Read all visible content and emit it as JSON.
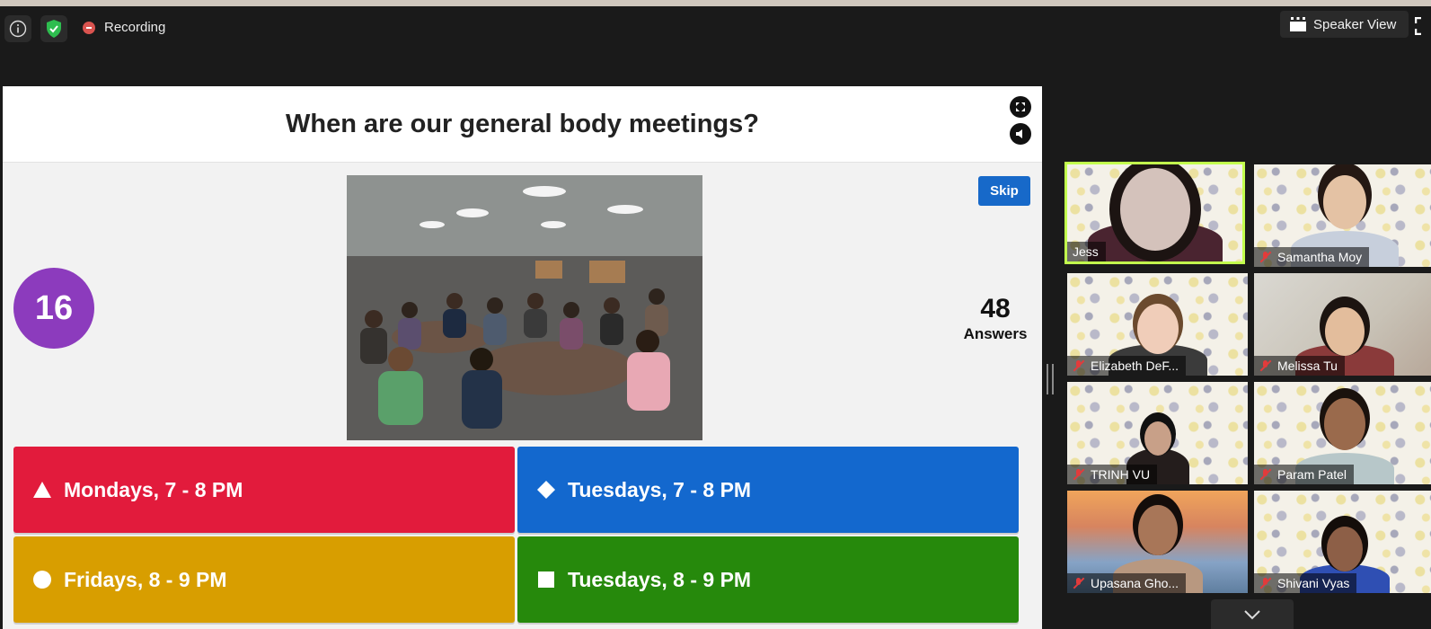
{
  "toolbar": {
    "recording_label": "Recording",
    "speaker_view_label": "Speaker View"
  },
  "question": {
    "text": "When are our general body meetings?",
    "skip_label": "Skip",
    "timer": "16",
    "answers_count": "48",
    "answers_label": "Answers",
    "options": [
      {
        "label": "Mondays, 7 - 8 PM",
        "shape": "triangle-icon",
        "color": "#e21b3c"
      },
      {
        "label": "Tuesdays, 7 - 8 PM",
        "shape": "diamond-icon",
        "color": "#1368ce"
      },
      {
        "label": "Fridays, 8 - 9 PM",
        "shape": "circle-icon",
        "color": "#d89e00"
      },
      {
        "label": "Tuesdays, 8 - 9 PM",
        "shape": "square-icon",
        "color": "#26890c"
      }
    ]
  },
  "participants": [
    {
      "name": "Jess",
      "muted": false,
      "active": true
    },
    {
      "name": "Samantha Moy",
      "muted": true
    },
    {
      "name": "Elizabeth DeF...",
      "muted": true
    },
    {
      "name": "Melissa Tu",
      "muted": true
    },
    {
      "name": "TRINH VU",
      "muted": true
    },
    {
      "name": "Param Patel",
      "muted": true
    },
    {
      "name": "Upasana Gho...",
      "muted": true
    },
    {
      "name": "Shivani Vyas",
      "muted": true
    }
  ],
  "colors": {
    "purple_timer": "#8c3bbd",
    "skip_blue": "#1769c9",
    "active_speaker": "#c2ff4d"
  }
}
